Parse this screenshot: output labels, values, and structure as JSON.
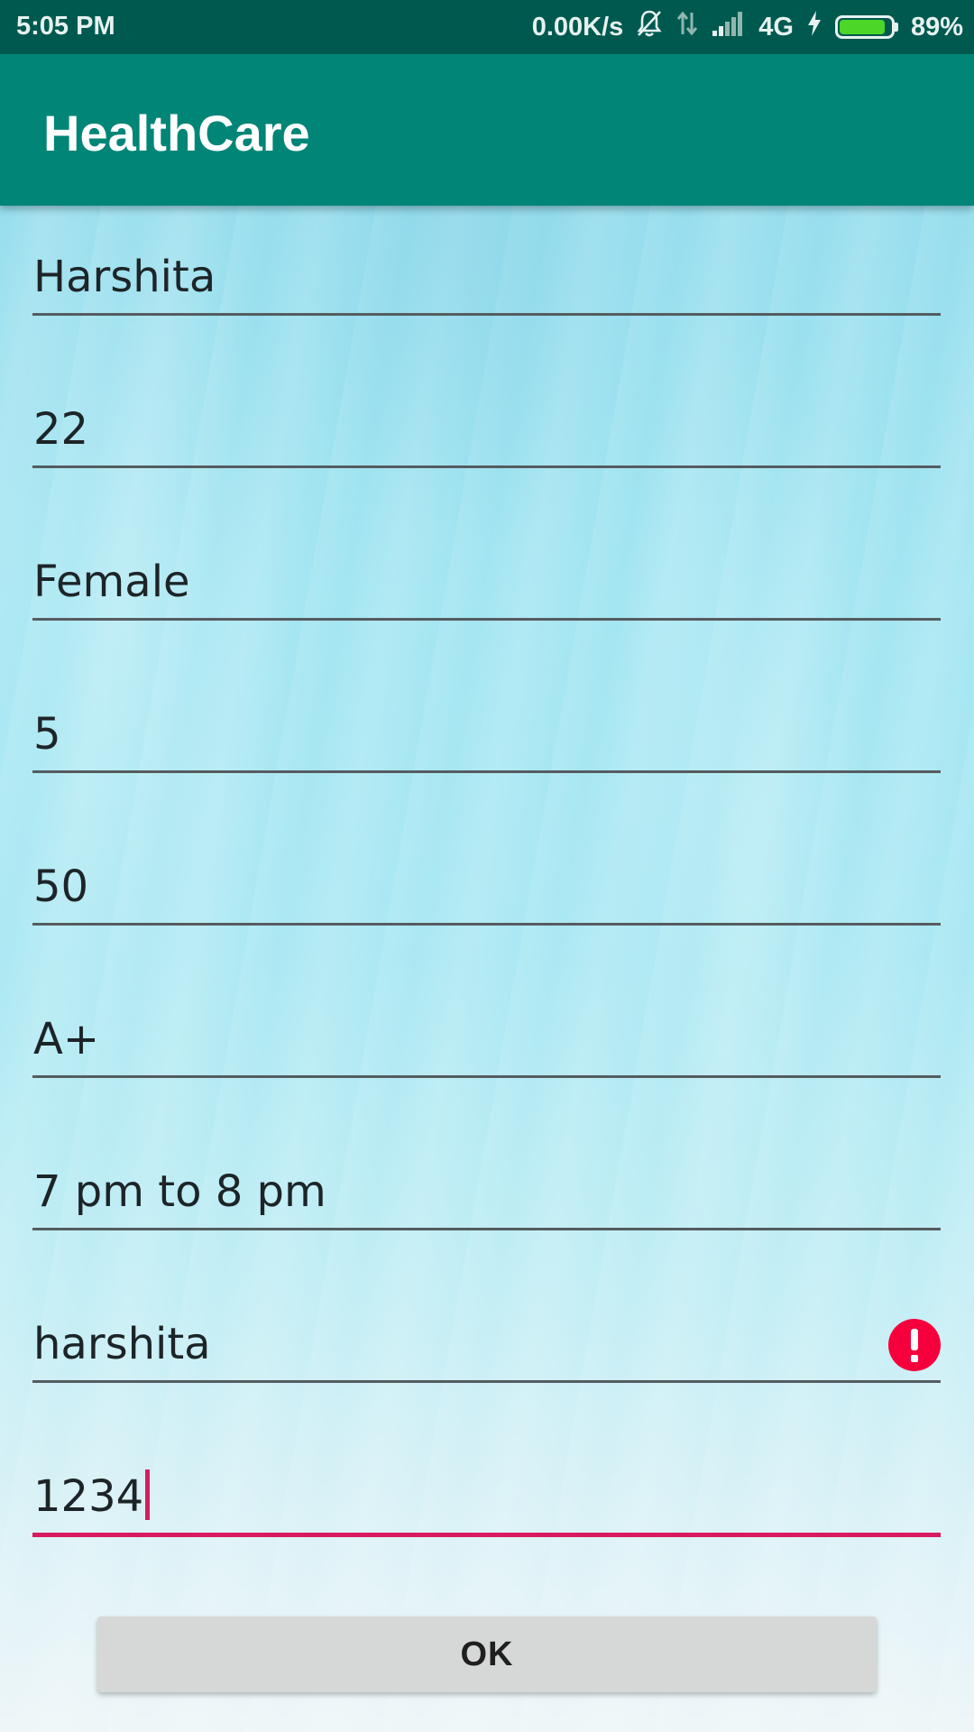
{
  "status_bar": {
    "time": "5:05 PM",
    "net_speed": "0.00K/s",
    "network_type": "4G",
    "battery_percent": "89%",
    "battery_level": 0.89,
    "icons": [
      "mute-bell-icon",
      "data-arrows-icon",
      "signal-icon",
      "charging-bolt-icon",
      "battery-icon"
    ]
  },
  "app_bar": {
    "title": "HealthCare",
    "color": "#008577"
  },
  "form": {
    "fields": [
      {
        "name": "name",
        "value": "Harshita"
      },
      {
        "name": "age",
        "value": "22"
      },
      {
        "name": "gender",
        "value": "Female"
      },
      {
        "name": "height",
        "value": "5"
      },
      {
        "name": "weight",
        "value": "50"
      },
      {
        "name": "blood-group",
        "value": "A+"
      },
      {
        "name": "timing",
        "value": "7 pm to 8 pm"
      },
      {
        "name": "username",
        "value": "harshita",
        "error": true
      },
      {
        "name": "password",
        "value": "1234",
        "focused": true
      }
    ],
    "accent_color": "#d81b60",
    "error_color": "#f5003d"
  },
  "ok_button": {
    "label": "OK"
  }
}
